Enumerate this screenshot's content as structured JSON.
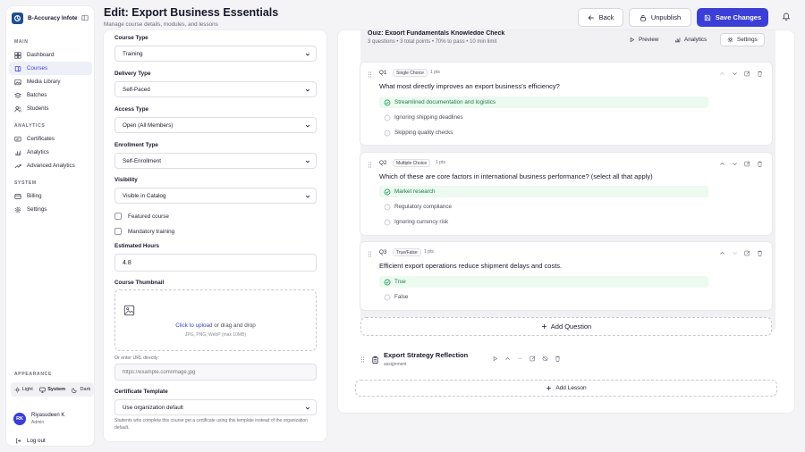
{
  "app": {
    "name": "B-Accuracy Infotech"
  },
  "sidebar": {
    "main_label": "MAIN",
    "main_items": [
      {
        "label": "Dashboard",
        "icon": "dashboard-icon"
      },
      {
        "label": "Courses",
        "icon": "book-icon",
        "active": true
      },
      {
        "label": "Media Library",
        "icon": "image-icon"
      },
      {
        "label": "Batches",
        "icon": "layers-icon"
      },
      {
        "label": "Students",
        "icon": "users-icon"
      }
    ],
    "analytics_label": "ANALYTICS",
    "analytics_items": [
      {
        "label": "Certificates",
        "icon": "certificate-icon"
      },
      {
        "label": "Analytics",
        "icon": "chart-icon"
      },
      {
        "label": "Advanced Analytics",
        "icon": "trend-icon"
      }
    ],
    "system_label": "SYSTEM",
    "system_items": [
      {
        "label": "Billing",
        "icon": "card-icon"
      },
      {
        "label": "Settings",
        "icon": "gear-icon"
      }
    ],
    "appearance_label": "APPEARANCE",
    "appearance": {
      "light": "Light",
      "system": "System",
      "dark": "Dark",
      "selected": "System"
    },
    "user": {
      "initials": "RK",
      "name": "Riyasudeen K",
      "role": "Admin"
    },
    "logout": "Log out"
  },
  "header": {
    "title": "Edit: Export Business Essentials",
    "subtitle": "Manage course details, modules, and lessons",
    "back": "Back",
    "unpublish": "Unpublish",
    "save": "Save Changes"
  },
  "form": {
    "course_type": {
      "label": "Course Type",
      "value": "Training"
    },
    "delivery_type": {
      "label": "Delivery Type",
      "value": "Self-Paced"
    },
    "access_type": {
      "label": "Access Type",
      "value": "Open (All Members)"
    },
    "enrollment_type": {
      "label": "Enrollment Type",
      "value": "Self-Enrollment"
    },
    "visibility": {
      "label": "Visibility",
      "value": "Visible in Catalog"
    },
    "featured": {
      "label": "Featured course",
      "checked": false
    },
    "mandatory": {
      "label": "Mandatory training",
      "checked": false
    },
    "hours": {
      "label": "Estimated Hours",
      "value": "4.8"
    },
    "thumbnail": {
      "label": "Course Thumbnail",
      "link": "Click to upload",
      "rest": " or drag and drop",
      "hint": "JPG, PNG, WebP (max 10MB)",
      "url_label": "Or enter URL directly:",
      "url_placeholder": "https://example.com/image.jpg"
    },
    "certificate": {
      "label": "Certificate Template",
      "value": "Use organization default",
      "help": "Students who complete this course get a certificate using this template instead of the organization default."
    }
  },
  "quiz": {
    "title": "Quiz: Export Fundamentals Knowledge Check",
    "meta": "3 questions • 3 total points • 70% to pass • 10 min limit",
    "preview": "Preview",
    "analytics": "Analytics",
    "settings": "Settings",
    "questions": [
      {
        "num": "Q1",
        "type": "Single Choice",
        "points": "1 pts",
        "text": "What most directly improves an export business's efficiency?",
        "options": [
          {
            "text": "Streamlined documentation and logistics",
            "correct": true
          },
          {
            "text": "Ignoring shipping deadlines",
            "correct": false
          },
          {
            "text": "Skipping quality checks",
            "correct": false
          }
        ]
      },
      {
        "num": "Q2",
        "type": "Multiple Choice",
        "points": "1 pts",
        "text": "Which of these are core factors in international business performance? (select all that apply)",
        "options": [
          {
            "text": "Market research",
            "correct": true
          },
          {
            "text": "Regulatory compliance",
            "correct": false
          },
          {
            "text": "Ignoring currency risk",
            "correct": false
          }
        ]
      },
      {
        "num": "Q3",
        "type": "True/False",
        "points": "1 pts",
        "text": "Efficient export operations reduce shipment delays and costs.",
        "options": [
          {
            "text": "True",
            "correct": true
          },
          {
            "text": "False",
            "correct": false
          }
        ]
      }
    ],
    "add_question": "Add Question"
  },
  "lesson": {
    "title": "Export Strategy Reflection",
    "type": "assignment"
  },
  "add_lesson": "Add Lesson",
  "colors": {
    "primary": "#3b3fd8",
    "correct": "#1f7a46",
    "correct_bg": "#ecfaf0"
  }
}
